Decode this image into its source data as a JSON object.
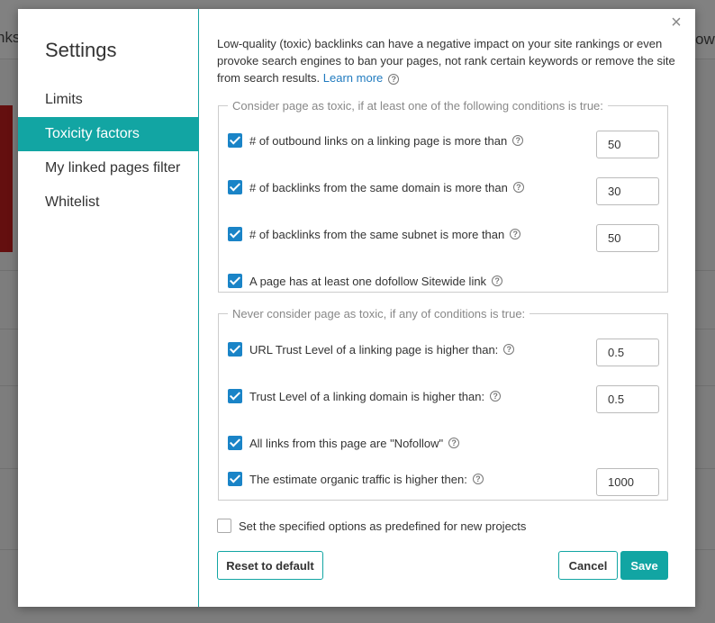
{
  "background": {
    "left_text": "nks",
    "right_text": "ow"
  },
  "sidebar": {
    "title": "Settings",
    "items": [
      {
        "label": "Limits"
      },
      {
        "label": "Toxicity factors"
      },
      {
        "label": "My linked pages filter"
      },
      {
        "label": "Whitelist"
      }
    ]
  },
  "close_label": "×",
  "help_glyph": "?",
  "intro": {
    "text": "Low-quality (toxic) backlinks can have a negative impact on your site rankings or even provoke search engines to ban your pages, not rank certain keywords or remove the site from search results.",
    "link": "Learn more"
  },
  "toxic_group": {
    "legend": "Consider page as toxic, if at least one of the following conditions is true:",
    "rows": [
      {
        "label": "# of outbound links on a linking page is more than",
        "checked": true,
        "value": "50"
      },
      {
        "label": "# of backlinks from the same domain is more than",
        "checked": true,
        "value": "30"
      },
      {
        "label": "# of backlinks from the same subnet is more than",
        "checked": true,
        "value": "50"
      },
      {
        "label": "A page has at least one dofollow Sitewide link",
        "checked": true
      }
    ]
  },
  "nontoxic_group": {
    "legend": "Never consider page as toxic, if any of conditions is true:",
    "rows": [
      {
        "label": "URL Trust Level of a linking page is higher than:",
        "checked": true,
        "value": "0.5"
      },
      {
        "label": "Trust Level of a linking domain is higher than:",
        "checked": true,
        "value": "0.5"
      },
      {
        "label": "All links from this page are \"Nofollow\"",
        "checked": true
      },
      {
        "label": "The estimate organic traffic is higher then:",
        "checked": true,
        "value": "1000"
      }
    ]
  },
  "predefined": {
    "label": "Set the specified options as predefined for new projects",
    "checked": false
  },
  "buttons": {
    "reset": "Reset to default",
    "cancel": "Cancel",
    "save": "Save"
  },
  "colors": {
    "accent": "#12a5a3",
    "checkbox": "#1a84c7",
    "link": "#1f7abf"
  }
}
